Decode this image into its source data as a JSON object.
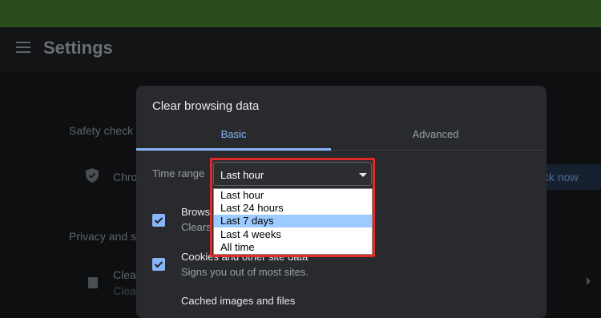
{
  "header": {
    "title": "Settings"
  },
  "background": {
    "safety_check_title": "Safety check",
    "safety_row_text": "Chro",
    "check_now_button": "ck now",
    "privacy_title": "Privacy and s",
    "clear_row_title": "Clear",
    "clear_row_sub": "Clea"
  },
  "dialog": {
    "title": "Clear browsing data",
    "tabs": [
      {
        "label": "Basic",
        "active": true
      },
      {
        "label": "Advanced",
        "active": false
      }
    ],
    "time_range": {
      "label": "Time range",
      "selected": "Last hour",
      "options": [
        "Last hour",
        "Last 24 hours",
        "Last 7 days",
        "Last 4 weeks",
        "All time"
      ],
      "highlighted_option": "Last 7 days"
    },
    "items": [
      {
        "title": "Brows",
        "subtitle": "Clears",
        "checked": true
      },
      {
        "title": "Cookies and other site data",
        "subtitle": "Signs you out of most sites.",
        "checked": true
      },
      {
        "title": "Cached images and files",
        "checked": true
      }
    ]
  },
  "colors": {
    "accent": "#8ab4f8",
    "highlight_box": "#e02a2a",
    "option_highlight": "#9ecbff"
  },
  "icons": [
    "menu-icon",
    "shield-icon",
    "trash-icon",
    "chevron-right-icon",
    "chevron-down-icon",
    "checkmark-icon"
  ]
}
